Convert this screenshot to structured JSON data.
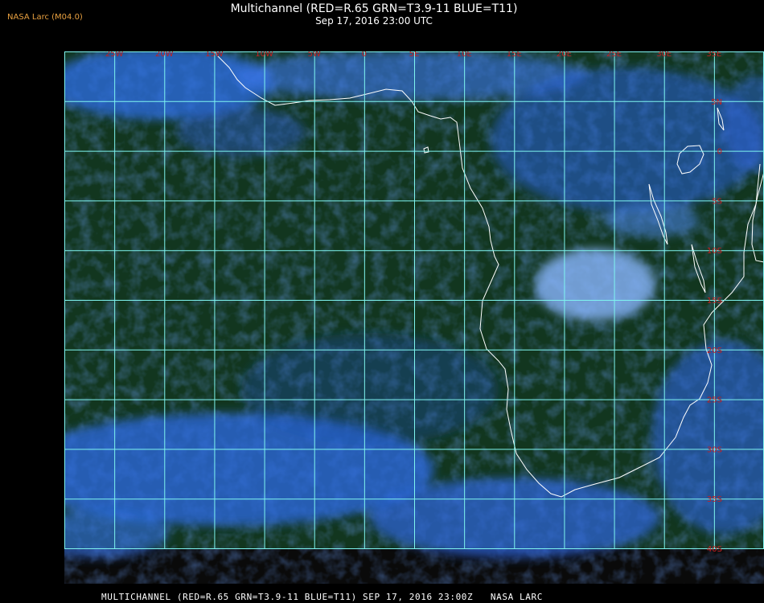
{
  "header": {
    "brand": "NASA Larc (M04.0)",
    "title": "Multichannel (RED=R.65 GRN=T3.9-11 BLUE=T11)",
    "subtitle": "Sep 17, 2016 23:00 UTC"
  },
  "footer": {
    "caption": "MULTICHANNEL (RED=R.65 GRN=T3.9-11 BLUE=T11) SEP 17, 2016 23:00Z   NASA LARC"
  },
  "map": {
    "lon_labels": [
      "25W",
      "20W",
      "15W",
      "10W",
      "5W",
      "0",
      "5E",
      "10E",
      "15E",
      "20E",
      "25E",
      "30E",
      "35E"
    ],
    "lat_labels": [
      "5N",
      "0",
      "5S",
      "10S",
      "15S",
      "20S",
      "25S",
      "30S",
      "35S",
      "40S"
    ],
    "lon_range": [
      -30,
      40
    ],
    "lat_range": [
      10,
      -40
    ],
    "grid_step_deg": 5,
    "colors": {
      "grid": "#7ff5f0",
      "label": "#c81e1e",
      "coast": "#ffffff",
      "ocean": "#12361f",
      "no_data": "#0a0a0a"
    }
  }
}
